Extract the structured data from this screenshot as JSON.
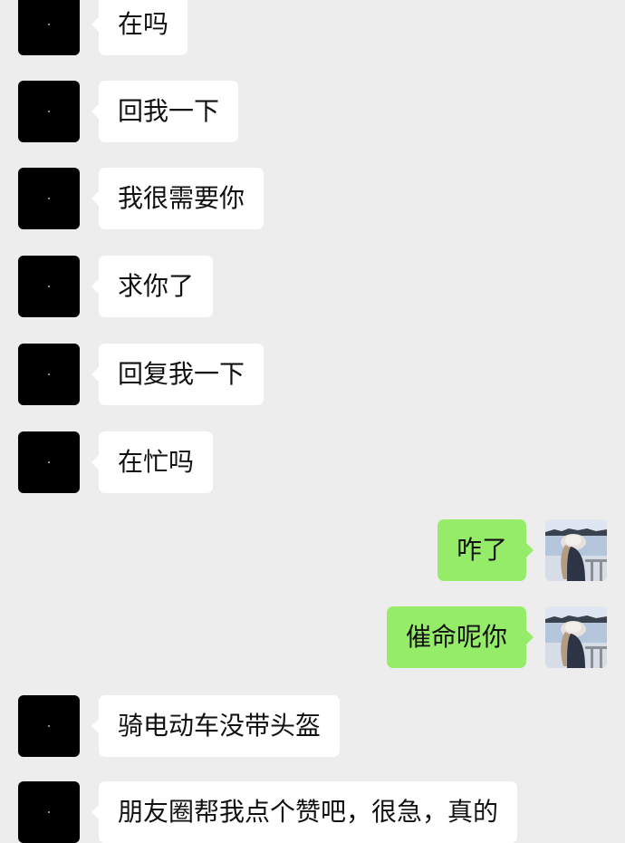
{
  "chat": {
    "messages": [
      {
        "direction": "incoming",
        "avatar": "black-avatar-icon",
        "text": "在吗"
      },
      {
        "direction": "incoming",
        "avatar": "black-avatar-icon",
        "text": "回我一下"
      },
      {
        "direction": "incoming",
        "avatar": "black-avatar-icon",
        "text": "我很需要你"
      },
      {
        "direction": "incoming",
        "avatar": "black-avatar-icon",
        "text": "求你了"
      },
      {
        "direction": "incoming",
        "avatar": "black-avatar-icon",
        "text": "回复我一下"
      },
      {
        "direction": "incoming",
        "avatar": "black-avatar-icon",
        "text": "在忙吗"
      },
      {
        "direction": "outgoing",
        "avatar": "user-photo-avatar",
        "text": "咋了"
      },
      {
        "direction": "outgoing",
        "avatar": "user-photo-avatar",
        "text": "催命呢你"
      },
      {
        "direction": "incoming",
        "avatar": "black-avatar-icon",
        "text": "骑电动车没带头盔"
      },
      {
        "direction": "incoming",
        "avatar": "black-avatar-icon",
        "text": "朋友圈帮我点个赞吧，很急，真的"
      }
    ]
  },
  "colors": {
    "background": "#ededed",
    "incoming_bubble": "#ffffff",
    "outgoing_bubble": "#95ec69",
    "text": "#111111",
    "contact_avatar": "#000000"
  }
}
